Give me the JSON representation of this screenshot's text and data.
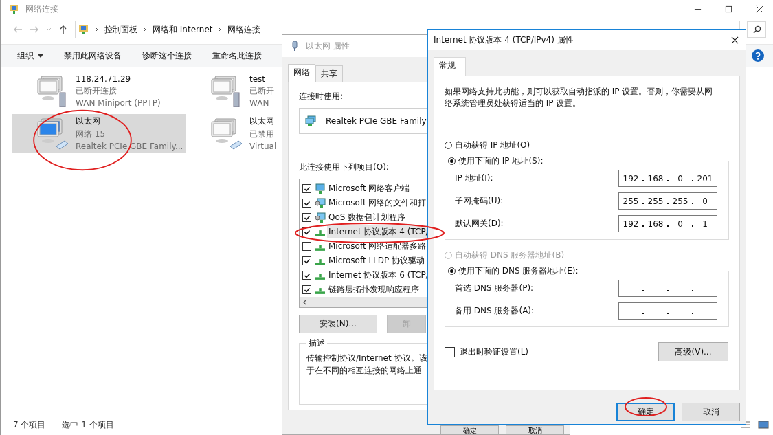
{
  "explorer": {
    "title": "网络连接",
    "breadcrumb": [
      "控制面板",
      "网络和 Internet",
      "网络连接"
    ],
    "toolbar": [
      {
        "label": "组织",
        "dropdown": true
      },
      {
        "label": "禁用此网络设备",
        "dropdown": false
      },
      {
        "label": "诊断这个连接",
        "dropdown": false
      },
      {
        "label": "重命名此连接",
        "dropdown": false
      }
    ],
    "connections": [
      {
        "name": "118.24.71.29",
        "status": "已断开连接",
        "device": "WAN Miniport (PPTP)",
        "kind": "vpn",
        "selected": false
      },
      {
        "name": "test",
        "status": "已断开",
        "device": "WAN",
        "kind": "vpn",
        "selected": false
      },
      {
        "name": "以太网",
        "status": "网络 15",
        "device": "Realtek PCIe GBE Family...",
        "kind": "ethernet",
        "selected": true
      },
      {
        "name": "以太网",
        "status": "已禁用",
        "device": "Virtual",
        "kind": "ethernet",
        "selected": false
      }
    ],
    "status": [
      "7 个项目",
      "选中 1 个项目"
    ]
  },
  "properties": {
    "title": "以太网 属性",
    "tabs": [
      {
        "label": "网络",
        "selected": true
      },
      {
        "label": "共享",
        "selected": false
      }
    ],
    "connect_using_label": "连接时使用:",
    "adapter": "Realtek PCIe GBE Family",
    "items_label": "此连接使用下列项目(O):",
    "items": [
      {
        "label": "Microsoft 网络客户端",
        "checked": true,
        "kind": "client",
        "selected": false
      },
      {
        "label": "Microsoft 网络的文件和打",
        "checked": true,
        "kind": "service",
        "selected": false
      },
      {
        "label": "QoS 数据包计划程序",
        "checked": true,
        "kind": "service",
        "selected": false
      },
      {
        "label": "Internet 协议版本 4 (TCP/",
        "checked": true,
        "kind": "protocol",
        "selected": true
      },
      {
        "label": "Microsoft 网络适配器多路",
        "checked": false,
        "kind": "protocol",
        "selected": false
      },
      {
        "label": "Microsoft LLDP 协议驱动",
        "checked": true,
        "kind": "protocol",
        "selected": false
      },
      {
        "label": "Internet 协议版本 6 (TCP/",
        "checked": true,
        "kind": "protocol",
        "selected": false
      },
      {
        "label": "链路层拓扑发现响应程序",
        "checked": true,
        "kind": "protocol",
        "selected": false
      }
    ],
    "buttons": [
      {
        "label": "安装(N)...",
        "disabled": false
      },
      {
        "label": "卸",
        "disabled": true
      }
    ],
    "description_title": "描述",
    "description": [
      "传输控制协议/Internet 协议。该",
      "于在不同的相互连接的网络上通"
    ],
    "footer_buttons": [
      "确定",
      "取消"
    ]
  },
  "ipv4": {
    "title": "Internet 协议版本 4 (TCP/IPv4) 属性",
    "tabs": [
      {
        "label": "常规",
        "selected": true
      }
    ],
    "intro": "如果网络支持此功能，则可以获取自动指派的 IP 设置。否则，你需要从网络系统管理员处获得适当的 IP 设置。",
    "ip_mode": [
      {
        "label": "自动获得 IP 地址(O)",
        "selected": false,
        "disabled": false
      },
      {
        "label": "使用下面的 IP 地址(S):",
        "selected": true,
        "disabled": false
      }
    ],
    "ip_fields": [
      {
        "label": "IP 地址(I):",
        "octets": [
          "192",
          "168",
          "0",
          "201"
        ]
      },
      {
        "label": "子网掩码(U):",
        "octets": [
          "255",
          "255",
          "255",
          "0"
        ]
      },
      {
        "label": "默认网关(D):",
        "octets": [
          "192",
          "168",
          "0",
          "1"
        ]
      }
    ],
    "dns_mode": [
      {
        "label": "自动获得 DNS 服务器地址(B)",
        "selected": false,
        "disabled": true
      },
      {
        "label": "使用下面的 DNS 服务器地址(E):",
        "selected": true,
        "disabled": false
      }
    ],
    "dns_fields": [
      {
        "label": "首选 DNS 服务器(P):"
      },
      {
        "label": "备用 DNS 服务器(A):"
      }
    ],
    "validate": {
      "label": "退出时验证设置(L)",
      "checked": false
    },
    "advanced": "高级(V)...",
    "buttons": [
      {
        "label": "确定",
        "default": true
      },
      {
        "label": "取消",
        "default": false
      }
    ]
  }
}
